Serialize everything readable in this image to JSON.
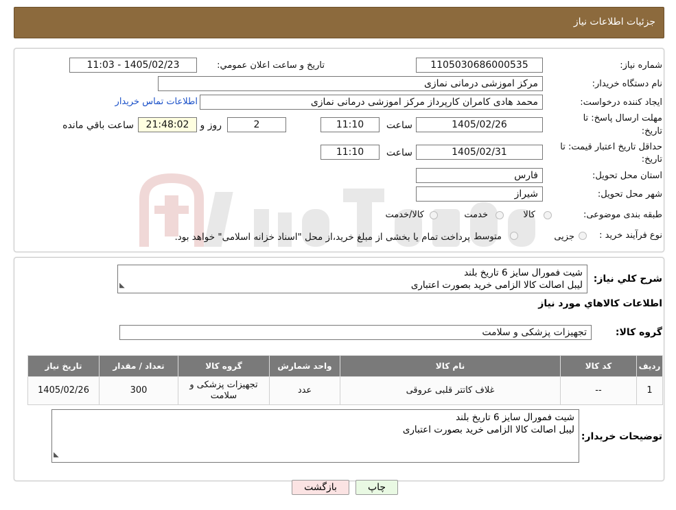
{
  "header": {
    "title": "جزئیات اطلاعات نیاز"
  },
  "form": {
    "need_number_label": "شماره نیاز:",
    "need_number": "1105030686000535",
    "announce_label": "تاريخ و ساعت اعلان عمومي:",
    "announce_value": "1405/02/23 - 11:03",
    "buyer_org_label": "نام دستگاه خریدار:",
    "buyer_org": "مرکز اموزشی درمانی نمازی",
    "requester_label": "ایجاد کننده درخواست:",
    "requester": "محمد هادی کامران کارپرداز مرکز اموزشی درمانی نمازی",
    "contact_link": "اطلاعات تماس خریدار",
    "deadline_label_1": "مهلت ارسال پاسخ: تا",
    "deadline_label_2": "تاریخ:",
    "deadline_date": "1405/02/26",
    "time_label": "ساعت",
    "deadline_time": "11:10",
    "days_value": "2",
    "days_label": "روز و",
    "remaining_time": "21:48:02",
    "remaining_label": "ساعت باقي مانده",
    "validity_label_1": "حداقل تاریخ اعتبار قیمت: تا",
    "validity_label_2": "تاریخ:",
    "validity_date": "1405/02/31",
    "validity_time": "11:10",
    "province_label": "استان محل تحویل:",
    "province": "فارس",
    "city_label": "شهر محل تحویل:",
    "city": "شیراز",
    "category_label": "طبقه بندی موضوعی:",
    "category_options": [
      "کالا",
      "خدمت",
      "کالا/خدمت"
    ],
    "process_label": "نوع فرآیند خرید :",
    "process_options": [
      "جزیی",
      "متوسط"
    ],
    "process_note": "پرداخت تمام یا بخشی از مبلغ خرید،از محل \"اسناد خزانه اسلامی\" خواهد بود."
  },
  "description": {
    "label": "شرح کلي نياز:",
    "lines": [
      "شیت فمورال سایز 6 تاریخ بلند",
      "لیبل اصالت کالا الزامی خرید بصورت اعتباری"
    ]
  },
  "goods": {
    "section_title": "اطلاعات کالاهاي مورد نياز",
    "group_label": "گروه کالا:",
    "group_value": "تجهیزات پزشکی و سلامت",
    "columns": [
      "رديف",
      "کد کالا",
      "نام کالا",
      "واحد شمارش",
      "گروه کالا",
      "تعداد / مقدار",
      "تاريخ نياز"
    ],
    "rows": [
      {
        "idx": "1",
        "code": "--",
        "name": "غلاف کاتتر قلبی عروقی",
        "unit": "عدد",
        "group": "تجهیزات پزشکی و سلامت",
        "qty": "300",
        "date": "1405/02/26"
      }
    ]
  },
  "buyer_notes": {
    "label": "توضیحات خریدار:",
    "lines": [
      "شیت فمورال سایز 6 تاریخ بلند",
      "لیبل اصالت کالا الزامی خرید بصورت اعتباری"
    ]
  },
  "buttons": {
    "print": "چاپ",
    "back": "بازگشت"
  },
  "colors": {
    "header_bg": "#8c6a3d",
    "table_header_bg": "#7a7a7a",
    "print_btn_bg": "#e9f9e3",
    "back_btn_bg": "#fbe3e3",
    "link": "#1a50c8"
  }
}
